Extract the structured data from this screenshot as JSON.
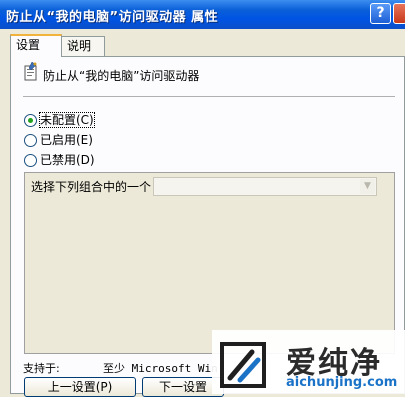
{
  "window": {
    "title": "防止从“我的电脑”访问驱动器 属性",
    "help_button": "?",
    "close_button": "×"
  },
  "tabs": [
    {
      "label": "设置",
      "selected": true
    },
    {
      "label": "说明",
      "selected": false
    }
  ],
  "policy": {
    "name": "防止从“我的电脑”访问驱动器",
    "icon": "policy-setting-icon"
  },
  "radio_options": [
    {
      "label": "未配置(C)",
      "checked": true
    },
    {
      "label": "已启用(E)",
      "checked": false
    },
    {
      "label": "已禁用(D)",
      "checked": false
    }
  ],
  "options": {
    "label": "选择下列组合中的一个",
    "combo_value": ""
  },
  "support": {
    "label": "支持于:",
    "value": "至少 Microsoft Win"
  },
  "buttons": {
    "prev": "上一设置(P)",
    "next": "下一设置"
  },
  "watermark": {
    "brand": "爱纯净",
    "url": "aichunjing.com"
  },
  "colors": {
    "title_bar": "#0054e3",
    "dialog_bg": "#ece9d8",
    "tab_highlight": "#f2b33d",
    "radio_check": "#21a121",
    "watermark_url": "#1b73c8"
  }
}
